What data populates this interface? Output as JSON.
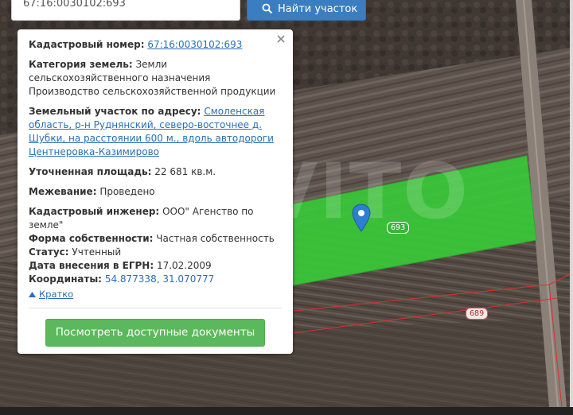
{
  "search": {
    "value": "67:16:0030102:693",
    "button_label": "Найти участок",
    "button_icon": "search-icon"
  },
  "popup": {
    "close_icon": "close-icon",
    "cadastral_number": {
      "label": "Кадастровый номер:",
      "value": "67:16:0030102:693"
    },
    "category": {
      "label": "Категория земель:",
      "value": "Земли сельскохозяйственного назначения Производство сельскохозяйственной продукции"
    },
    "address": {
      "label": "Земельный участок по адресу:",
      "value": "Смоленская область, р-н Руднянский, северо-восточнее д. Шубки, на расстоянии 600 м., вдоль автодороги Центнеровка-Казимирово"
    },
    "area": {
      "label": "Уточненная площадь:",
      "value": "22 681 кв.м."
    },
    "survey": {
      "label": "Межевание:",
      "value": "Проведено"
    },
    "engineer": {
      "label": "Кадастровый инженер:",
      "value": "ООО\" Агенство по земле\""
    },
    "ownership": {
      "label": "Форма собственности:",
      "value": "Частная собственность"
    },
    "status": {
      "label": "Статус:",
      "value": "Учтенный"
    },
    "egrn_date": {
      "label": "Дата внесения в ЕГРН:",
      "value": "17.02.2009"
    },
    "coordinates": {
      "label": "Координаты:",
      "value": "54.877338, 31.070777"
    },
    "toggle_label": "Кратко",
    "docs_button": "Посмотреть доступные документы"
  },
  "map": {
    "parcel_selected_label": "693",
    "parcel_neighbor_label": "689",
    "watermark": "AVITO",
    "colors": {
      "parcel_fill": "#38c938",
      "boundary": "#d93030",
      "link": "#2a6fb6",
      "button_green": "#5cb85c",
      "button_blue": "#3a7ec1",
      "marker": "#2f7fd0"
    }
  }
}
